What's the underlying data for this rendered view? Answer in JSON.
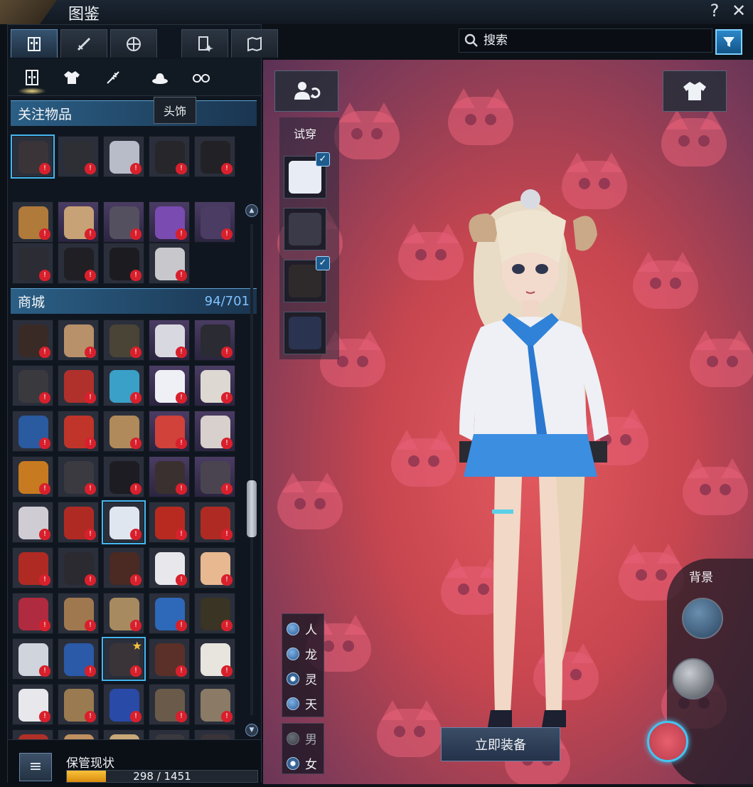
{
  "window": {
    "title": "图鉴",
    "help_label": "?",
    "close_label": "✕"
  },
  "colors": {
    "accent": "#45b6f0",
    "header_blue": "#2b5f86",
    "count_blue": "#7fc2ff",
    "badge_red": "#d8202c",
    "storage_fill": "#f0a818"
  },
  "top_tabs": [
    {
      "icon": "wardrobe-icon",
      "active": true
    },
    {
      "icon": "sword-icon",
      "active": false
    },
    {
      "icon": "lantern-icon",
      "active": false
    },
    {
      "icon": "card-spark-icon",
      "active": false
    },
    {
      "icon": "map-scroll-icon",
      "active": false
    }
  ],
  "sub_tabs": [
    {
      "icon": "wardrobe-icon",
      "active": true
    },
    {
      "icon": "outfit-icon",
      "active": false
    },
    {
      "icon": "weapon-skin-icon",
      "active": false
    },
    {
      "icon": "hat-icon",
      "active": false
    },
    {
      "icon": "glasses-icon",
      "active": false
    }
  ],
  "tooltip": {
    "text": "头饰"
  },
  "favorites": {
    "title": "关注物品",
    "items": [
      {
        "color": "#3a3438",
        "selected": true
      },
      {
        "color": "#2e2f35"
      },
      {
        "color": "#b8bcc8"
      },
      {
        "color": "#26262b"
      },
      {
        "color": "#222226"
      }
    ]
  },
  "upper_grid": {
    "items": [
      {
        "color": "#b07a3a",
        "purple": false
      },
      {
        "color": "#c7a277",
        "purple": true
      },
      {
        "color": "#555060",
        "purple": true
      },
      {
        "color": "#7a4bb0",
        "purple": true
      },
      {
        "color": "#4a3c63",
        "purple": true
      },
      {
        "color": "#2c2c34"
      },
      {
        "color": "#1f1f24"
      },
      {
        "color": "#1b1b20"
      },
      {
        "color": "#c8c8cc"
      }
    ]
  },
  "shop": {
    "title": "商城",
    "count": "94/701",
    "items": [
      "#3a2a26",
      "#b8906a",
      "#4a4436",
      "#d8d8e0",
      "#2b2b33",
      "#3a3a3e",
      "#b0302c",
      "#3aa0c8",
      "#eef0f6",
      "#ddd8d2",
      "#2a5aa0",
      "#c0342a",
      "#b08a5a",
      "#d0423a",
      "#d8d0cc",
      "#c87a20",
      "#3a3a40",
      "#1c1c22",
      "#3a3030",
      "#4a4450",
      "#d0ccd4",
      "#b02a24",
      "#dfe6f0",
      "#b82a20",
      "#b02a24",
      "#b02a24",
      "#2a2a30",
      "#4a2a22",
      "#e8e8ec",
      "#e8b890",
      "#b02a40",
      "#a07850",
      "#a88a60",
      "#2e68b8",
      "#3a3424",
      "#d0d4dc",
      "#2a5aa8",
      "#3a3438",
      "#5a3028",
      "#e8e4de",
      "#e8e8ec",
      "#9a7a50",
      "#2a4aa8",
      "#6a5a4a",
      "#8a7a66",
      "#b03028",
      "#c09060",
      "#c8a878",
      "#3a3a3e",
      "#3a3438"
    ],
    "selected_index": 22,
    "star_index": 37
  },
  "storage": {
    "menu_label": "≡",
    "label": "保管现状",
    "current": 298,
    "total": 1451,
    "text": "298 / 1451"
  },
  "search": {
    "placeholder": "搜索",
    "value": ""
  },
  "tryon": {
    "label": "试穿",
    "slots": [
      {
        "color": "#e8ecf4",
        "checked": true
      },
      {
        "color": "#3a3a48",
        "checked": false
      },
      {
        "color": "#2e2a2c",
        "checked": true
      },
      {
        "color": "#2a3450",
        "checked": false
      }
    ]
  },
  "race": {
    "options": [
      {
        "label": "人",
        "checked": false
      },
      {
        "label": "龙",
        "checked": false
      },
      {
        "label": "灵",
        "checked": true
      },
      {
        "label": "天",
        "checked": false
      }
    ]
  },
  "gender": {
    "options": [
      {
        "label": "男",
        "checked": false,
        "disabled": true
      },
      {
        "label": "女",
        "checked": true,
        "disabled": false
      }
    ]
  },
  "equip_button": {
    "label": "立即装备"
  },
  "background": {
    "label": "背景"
  }
}
